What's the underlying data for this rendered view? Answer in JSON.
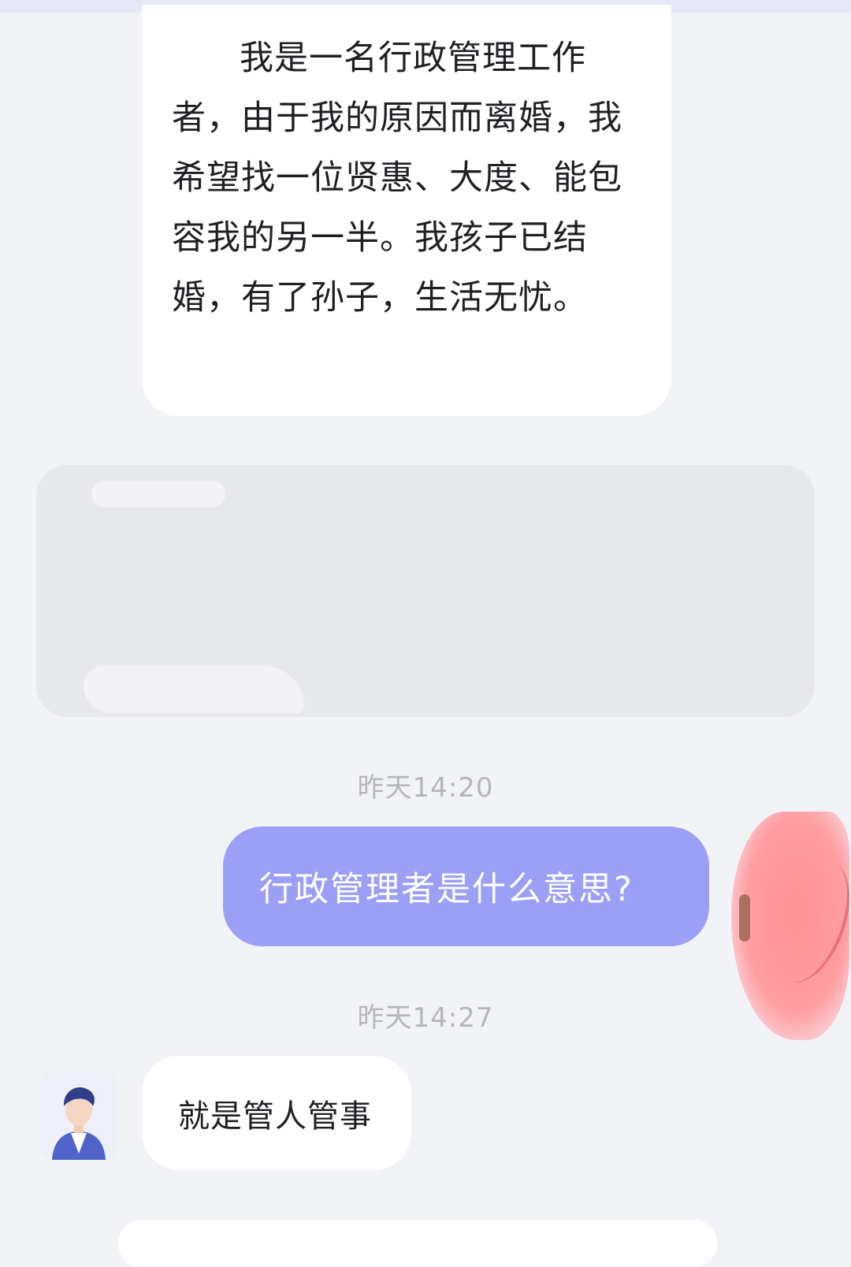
{
  "messages": [
    {
      "side": "left",
      "text": "我是一名行政管理工作者，由于我的原因而离婚，我希望找一位贤惠、大度、能包容我的另一半。我孩子已结婚，有了孙子，生活无忧。"
    },
    {
      "side": "left",
      "type": "redacted-card"
    },
    {
      "side": "right",
      "timestamp": "昨天14:20",
      "text": "行政管理者是什么意思?"
    },
    {
      "side": "left",
      "timestamp": "昨天14:27",
      "text": "就是管人管事"
    }
  ],
  "colors": {
    "background": "#f2f3f7",
    "incoming_bubble": "#ffffff",
    "outgoing_bubble": "#9ba0f6",
    "timestamp": "#b5b6bc"
  },
  "icons": {
    "sender_avatar": "male-cartoon-avatar-icon",
    "self_avatar": "redacted-avatar"
  }
}
